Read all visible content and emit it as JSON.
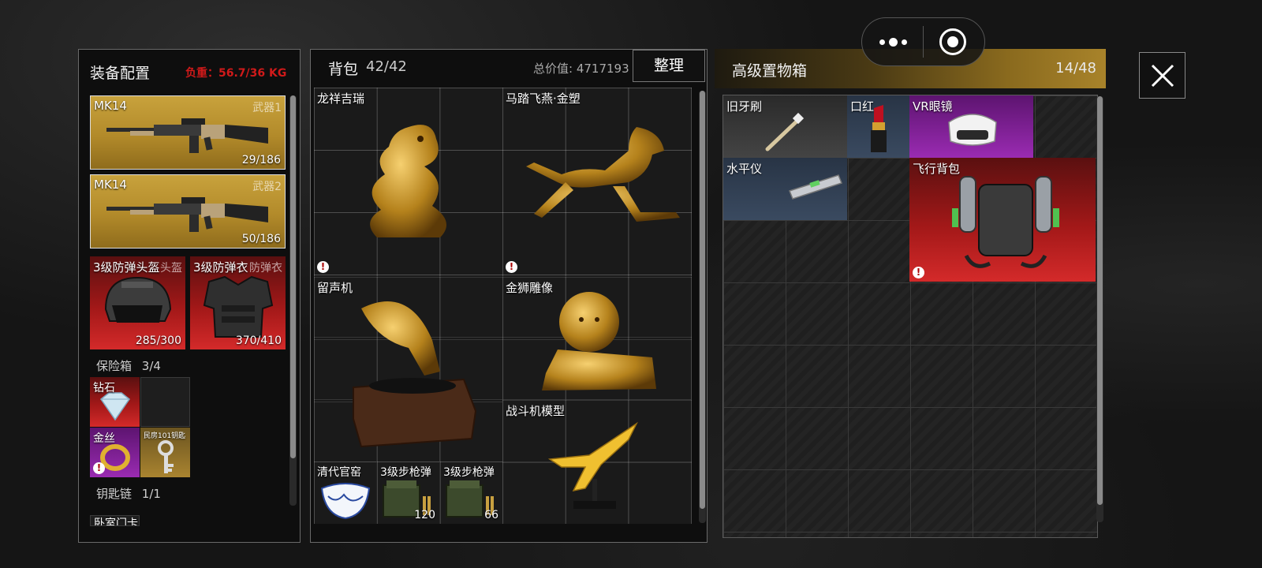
{
  "equipment": {
    "title": "装备配置",
    "weight": "负重：56.7/36 KG",
    "weapons": [
      {
        "name": "MK14",
        "slot": "武器1",
        "ammo": "29/186"
      },
      {
        "name": "MK14",
        "slot": "武器2",
        "ammo": "50/186"
      }
    ],
    "armor": [
      {
        "name": "3级防弹头盔",
        "slot": "头盔",
        "durability": "285/300"
      },
      {
        "name": "3级防弹衣",
        "slot": "防弹衣",
        "durability": "370/410"
      }
    ],
    "safe": {
      "label": "保险箱",
      "count": "3/4",
      "items": [
        {
          "name": "钻石",
          "rarity": "red"
        },
        {
          "name": "金丝",
          "rarity": "purple"
        },
        {
          "name": "民房101钥匙",
          "rarity": "ochre"
        }
      ]
    },
    "keychain": {
      "label": "钥匙链",
      "count": "1/1",
      "item": "卧室门卡"
    }
  },
  "backpack": {
    "title": "背包",
    "count": "42/42",
    "total_value": "总价值: 4717193",
    "sort_button": "整理",
    "items": [
      {
        "name": "龙祥吉瑞",
        "rarity": "red",
        "icon": "dragon-statue-icon"
      },
      {
        "name": "马踏飞燕·金塑",
        "rarity": "red",
        "icon": "horse-statue-icon"
      },
      {
        "name": "留声机",
        "rarity": "red",
        "icon": "gramophone-icon"
      },
      {
        "name": "金狮雕像",
        "rarity": "red",
        "icon": "lion-statue-icon"
      },
      {
        "name": "战斗机模型",
        "rarity": "red",
        "icon": "fighter-jet-icon"
      },
      {
        "name": "清代官窑",
        "rarity": "red",
        "icon": "porcelain-bowl-icon"
      },
      {
        "name": "3级步枪弹",
        "rarity": "red",
        "count": "120",
        "icon": "ammo-box-icon"
      },
      {
        "name": "3级步枪弹",
        "rarity": "red",
        "count": "66",
        "icon": "ammo-box-icon"
      }
    ]
  },
  "storage": {
    "title": "高级置物箱",
    "count": "14/48",
    "items": [
      {
        "name": "旧牙刷",
        "rarity": "grey",
        "icon": "toothbrush-icon"
      },
      {
        "name": "口红",
        "rarity": "blue",
        "icon": "lipstick-icon"
      },
      {
        "name": "VR眼镜",
        "rarity": "purple",
        "icon": "vr-headset-icon"
      },
      {
        "name": "水平仪",
        "rarity": "blue",
        "icon": "spirit-level-icon"
      },
      {
        "name": "飞行背包",
        "rarity": "red",
        "icon": "jetpack-icon"
      }
    ]
  },
  "capsule": {
    "menu_icon": "more-dots-icon",
    "target_icon": "record-target-icon"
  },
  "close_icon": "close-icon",
  "colors": {
    "gold": "#c8a23c",
    "red": "#b81e1e",
    "purple": "#9a2bb2",
    "blue": "#3a4a60",
    "weight_red": "#d01a1a",
    "header_gold": "#8a6a1e"
  }
}
